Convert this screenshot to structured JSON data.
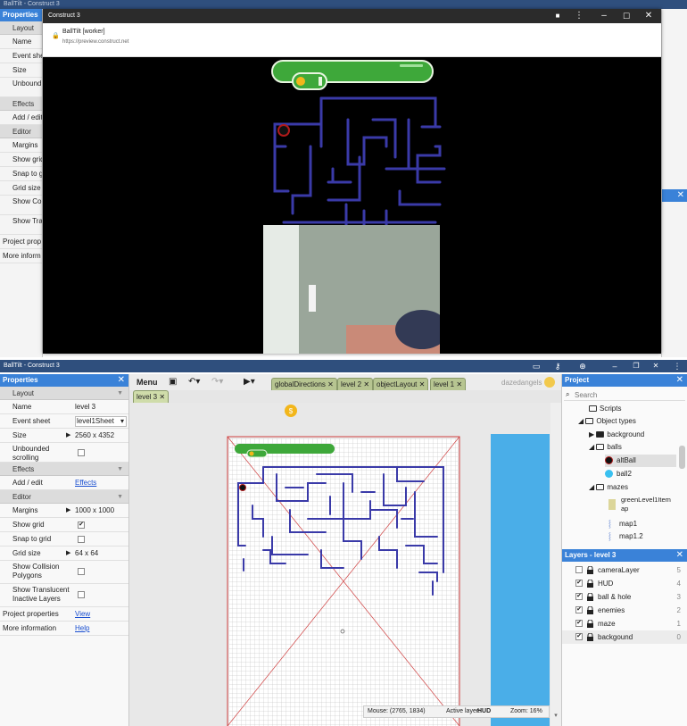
{
  "top_window": {
    "title": "BallTilt - Construct 3",
    "properties_header": "Properties",
    "props": [
      "Layout",
      "Name",
      "Event she",
      "Size",
      "Unbound scrolling",
      "Effects",
      "Add / edit",
      "Editor",
      "Margins",
      "Show grid",
      "Snap to g",
      "Grid size",
      "Show Coll Polygons",
      "Show Tra Inactive L",
      "Project prop",
      "More inform"
    ]
  },
  "preview": {
    "title": "Construct 3",
    "page_title": "BallTilt [worker]",
    "url": "https://preview.construct.net"
  },
  "editor": {
    "title": "BallTilt - Construct 3",
    "properties": {
      "header": "Properties",
      "layout_section": "Layout",
      "name_label": "Name",
      "name_value": "level 3",
      "eventsheet_label": "Event sheet",
      "eventsheet_value": "level1Sheet",
      "size_label": "Size",
      "size_value": "2560 x 4352",
      "unbounded_label": "Unbounded scrolling",
      "effects_section": "Effects",
      "addedit_label": "Add / edit",
      "addedit_value": "Effects",
      "editor_section": "Editor",
      "margins_label": "Margins",
      "margins_value": "1000 x 1000",
      "showgrid_label": "Show grid",
      "snap_label": "Snap to grid",
      "gridsize_label": "Grid size",
      "gridsize_value": "64 x 64",
      "collision_label": "Show Collision Polygons",
      "translucent_label": "Show Translucent Inactive Layers",
      "project_props_label": "Project properties",
      "project_props_value": "View",
      "more_info_label": "More information",
      "more_info_value": "Help"
    },
    "toolbar": {
      "menu": "Menu",
      "tabs": [
        "globalDirections",
        "level 2",
        "objectLayout",
        "level 1"
      ],
      "active_tab": "level 3",
      "user": "dazedangels"
    },
    "status": {
      "mouse": "Mouse: (2765, 1834)",
      "active_layer_label": "Active layer:",
      "active_layer": "HUD",
      "zoom": "Zoom: 16%"
    },
    "project": {
      "header": "Project",
      "search_placeholder": "Search",
      "items": {
        "scripts": "Scripts",
        "object_types": "Object types",
        "background": "background",
        "balls": "balls",
        "altball": "altBall",
        "ball2": "ball2",
        "mazes": "mazes",
        "greenlevel": "greenLevel1Item ap",
        "map1": "map1",
        "map12": "map1.2"
      }
    },
    "layers": {
      "header": "Layers - level 3",
      "items": [
        {
          "name": "cameraLayer",
          "index": "5",
          "checked": false
        },
        {
          "name": "HUD",
          "index": "4",
          "checked": true
        },
        {
          "name": "ball & hole",
          "index": "3",
          "checked": true
        },
        {
          "name": "enemies",
          "index": "2",
          "checked": true
        },
        {
          "name": "maze",
          "index": "1",
          "checked": true
        },
        {
          "name": "backgound",
          "index": "0",
          "checked": true
        }
      ]
    }
  },
  "colors": {
    "title_bar": "#2f4f7d",
    "panel_header": "#3a82d8",
    "maze_line": "#3a3aa8",
    "hud_green": "#3ea83a",
    "tab_green": "#b7c591",
    "sky_blue": "#4aaee8"
  }
}
